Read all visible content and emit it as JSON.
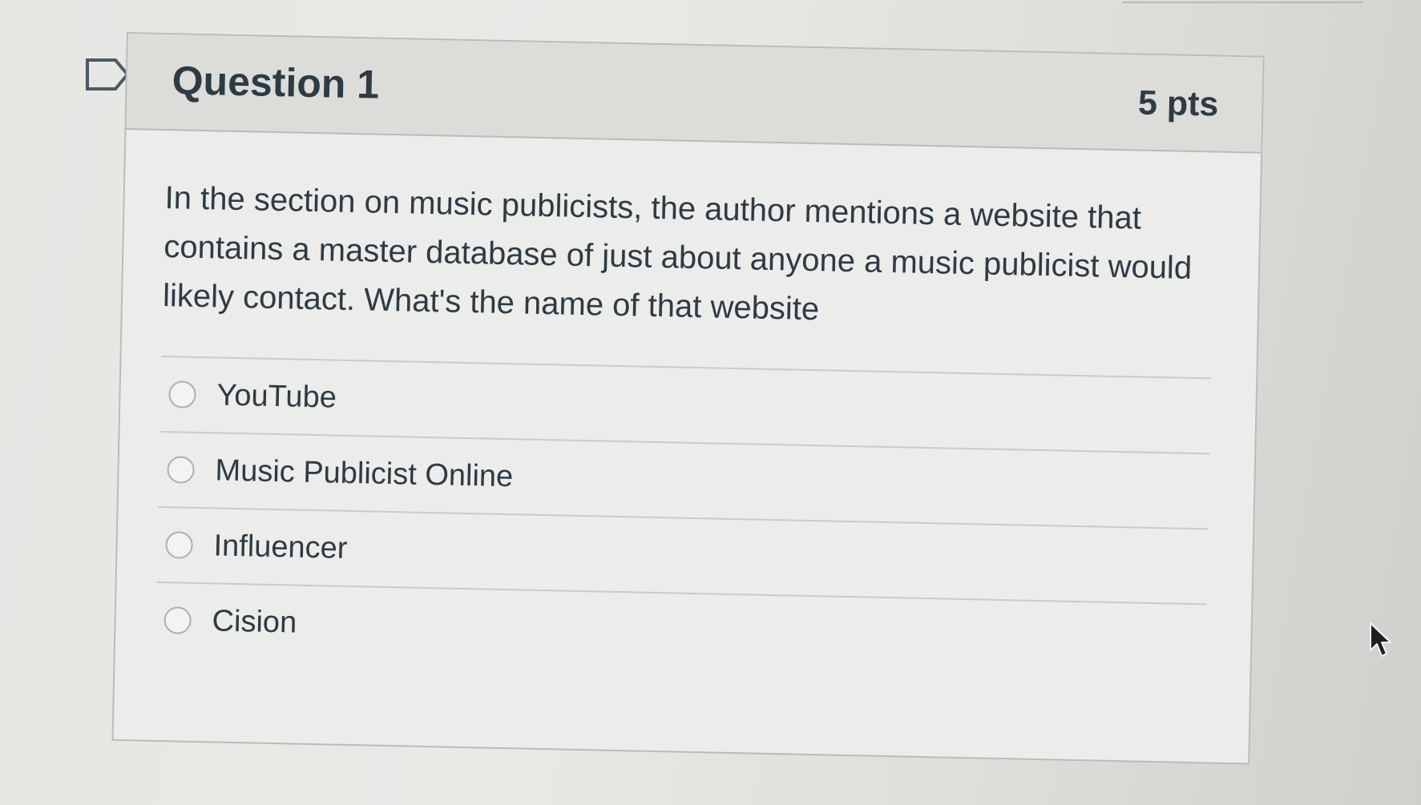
{
  "question": {
    "title": "Question 1",
    "points": "5 pts",
    "text": "In the section on music publicists, the author mentions a website that contains a master database of just about anyone a music publicist would likely contact. What's the name of that website",
    "answers": [
      {
        "label": "YouTube",
        "selected": false
      },
      {
        "label": "Music Publicist Online",
        "selected": false
      },
      {
        "label": "Influencer",
        "selected": false
      },
      {
        "label": "Cision",
        "selected": false
      }
    ]
  },
  "icons": {
    "flag": "bookmark-flag-icon",
    "cursor": "mouse-pointer-icon"
  },
  "colors": {
    "text": "#2d3b45",
    "header_bg": "#dcdcd9",
    "border": "#b9bcbc"
  }
}
